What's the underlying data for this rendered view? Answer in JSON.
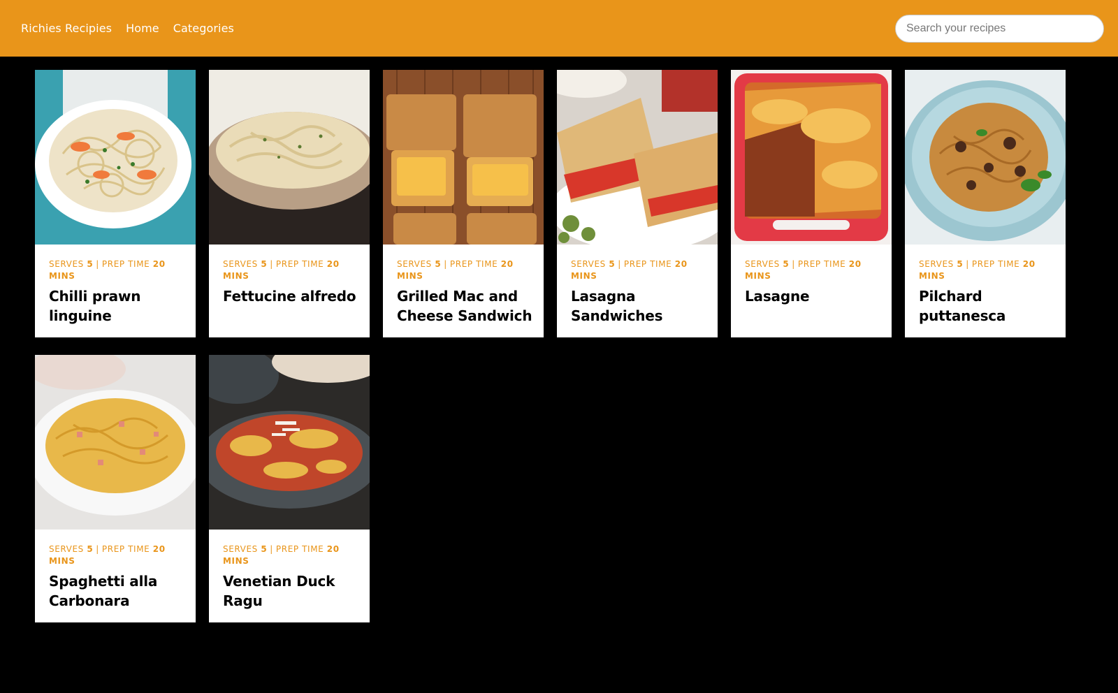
{
  "header": {
    "brand": "Richies Recipies",
    "nav": [
      {
        "label": "Home"
      },
      {
        "label": "Categories"
      }
    ],
    "search_placeholder": "Search your recipes",
    "background_color": "#E9951A"
  },
  "recipe_meta": {
    "serves_label": "SERVES",
    "prep_label": "PREP TIME",
    "separator": "|"
  },
  "recipes": [
    {
      "title": "Chilli prawn linguine",
      "serves": "5",
      "prep_time": "20 MINS",
      "image": "plated-pasta-with-prawns"
    },
    {
      "title": "Fettucine alfredo",
      "serves": "5",
      "prep_time": "20 MINS",
      "image": "bowl-of-fettuccine"
    },
    {
      "title": "Grilled Mac and Cheese Sandwich",
      "serves": "5",
      "prep_time": "20 MINS",
      "image": "toasted-sandwiches-on-wood"
    },
    {
      "title": "Lasagna Sandwiches",
      "serves": "5",
      "prep_time": "20 MINS",
      "image": "grilled-sandwich-with-tomato"
    },
    {
      "title": "Lasagne",
      "serves": "5",
      "prep_time": "20 MINS",
      "image": "lasagne-in-red-dish"
    },
    {
      "title": "Pilchard puttanesca",
      "serves": "5",
      "prep_time": "20 MINS",
      "image": "spaghetti-on-blue-plate"
    },
    {
      "title": "Spaghetti alla Carbonara",
      "serves": "5",
      "prep_time": "20 MINS",
      "image": "carbonara-in-white-bowl"
    },
    {
      "title": "Venetian Duck Ragu",
      "serves": "5",
      "prep_time": "20 MINS",
      "image": "pappardelle-ragu-on-dark-plate"
    }
  ]
}
